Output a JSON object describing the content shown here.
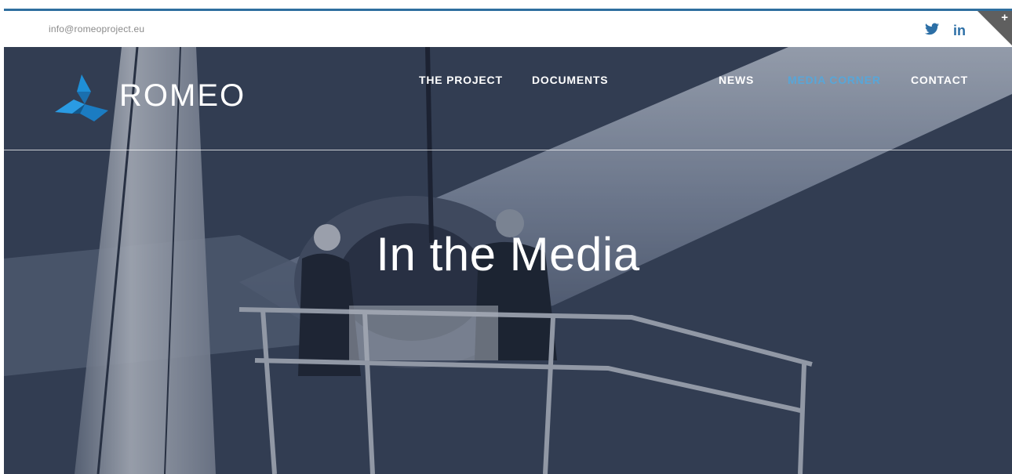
{
  "topbar": {
    "email": "info@romeoproject.eu",
    "social": [
      {
        "name": "twitter-icon"
      },
      {
        "name": "linkedin-icon",
        "label": "in"
      }
    ],
    "corner_toggle": "+"
  },
  "brand": {
    "name": "ROMEO"
  },
  "nav": {
    "items": [
      {
        "label": "THE PROJECT"
      },
      {
        "label": "DOCUMENTS"
      },
      {
        "label": "NEWS"
      },
      {
        "label": "MEDIA CORNER",
        "active": true
      },
      {
        "label": "CONTACT"
      }
    ]
  },
  "hero": {
    "title": "In the Media"
  },
  "colors": {
    "accent": "#2f6f9f",
    "nav_active": "#58a6d8",
    "hero_tint": "#3b475c",
    "logo_blue": "#1f8fd6"
  }
}
